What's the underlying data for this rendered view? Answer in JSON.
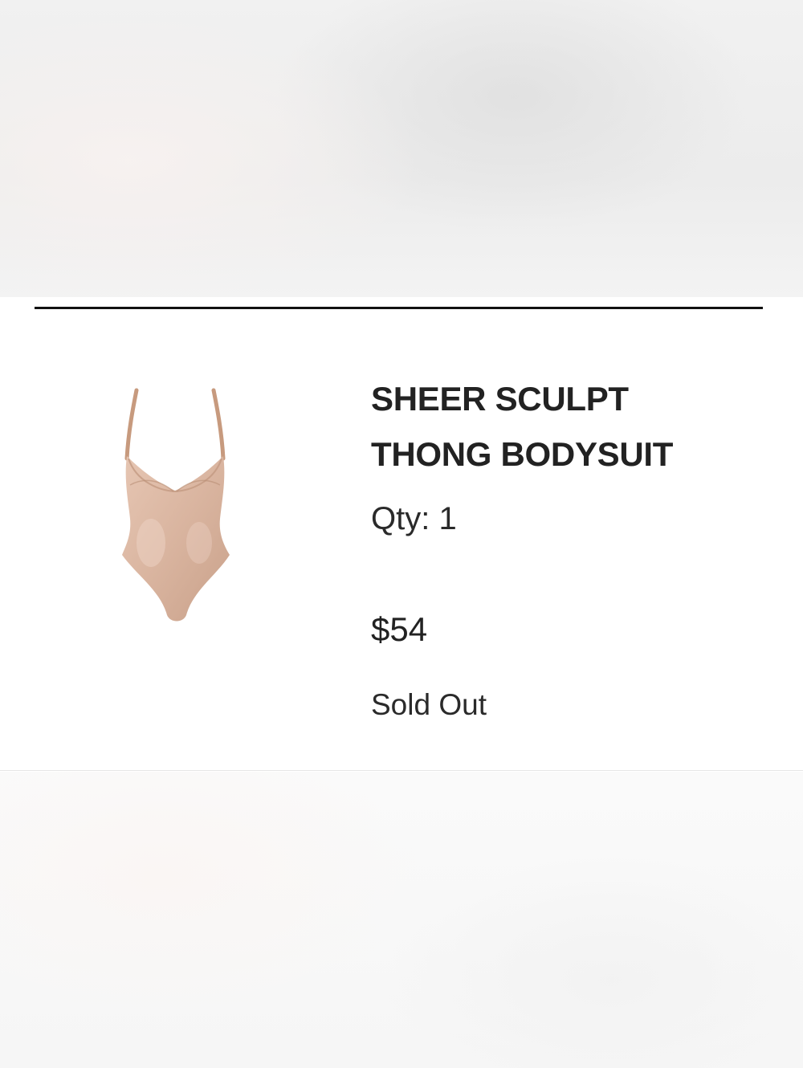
{
  "product": {
    "title_line1": "SHEER SCULPT",
    "title_line2": "THONG BODYSUIT",
    "quantity_label": "Qty:",
    "quantity": "1",
    "price": "$54",
    "status": "Sold Out",
    "image_icon": "bodysuit-product-image"
  },
  "colors": {
    "product_tone": "#d9b8a5",
    "text": "#222222",
    "divider": "#111111"
  }
}
